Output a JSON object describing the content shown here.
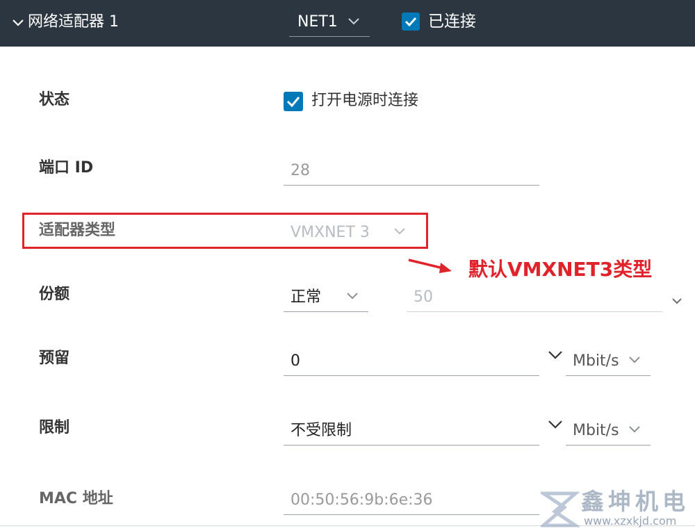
{
  "header": {
    "title": "网络适配器 1",
    "network_value": "NET1",
    "connected_label": "已连接"
  },
  "rows": {
    "status": {
      "label": "状态",
      "checkbox_label": "打开电源时连接"
    },
    "port_id": {
      "label": "端口 ID",
      "value": "28"
    },
    "adapter_type": {
      "label": "适配器类型",
      "value": "VMXNET 3"
    },
    "shares": {
      "label": "份额",
      "level": "正常",
      "value": "50"
    },
    "reservation": {
      "label": "预留",
      "value": "0",
      "unit": "Mbit/s"
    },
    "limit": {
      "label": "限制",
      "value": "不受限制",
      "unit": "Mbit/s"
    },
    "mac": {
      "label": "MAC 地址",
      "value": "00:50:56:9b:6e:36"
    }
  },
  "annotation": {
    "text": "默认VMXNET3类型",
    "color": "#e0232b"
  },
  "watermark": {
    "name": "鑫坤机电",
    "url": "www.xzxkjd.com"
  },
  "colors": {
    "header_bg": "#2b3640",
    "accent": "#0079b8",
    "highlight": "#e0232b"
  }
}
